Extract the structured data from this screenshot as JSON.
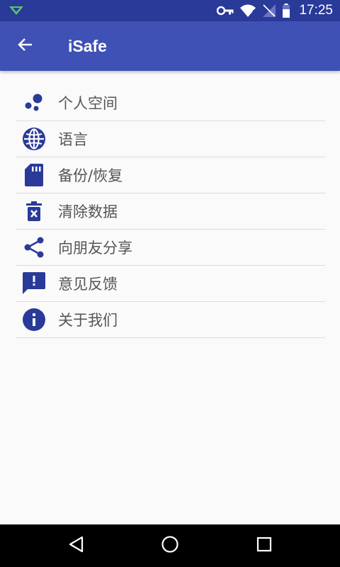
{
  "status_bar": {
    "time": "17:25"
  },
  "app_bar": {
    "title": "iSafe"
  },
  "menu": {
    "items": [
      {
        "label": "个人空间",
        "icon": "bubbles-icon"
      },
      {
        "label": "语言",
        "icon": "globe-icon"
      },
      {
        "label": "备份/恢复",
        "icon": "sd-card-icon"
      },
      {
        "label": "清除数据",
        "icon": "trash-icon"
      },
      {
        "label": "向朋友分享",
        "icon": "share-icon"
      },
      {
        "label": "意见反馈",
        "icon": "feedback-icon"
      },
      {
        "label": "关于我们",
        "icon": "info-icon"
      }
    ]
  },
  "colors": {
    "primary": "#3f51b5",
    "primary_dark": "#2a3a99",
    "icon": "#2a3a99",
    "text": "#555555",
    "background": "#fafafa"
  }
}
